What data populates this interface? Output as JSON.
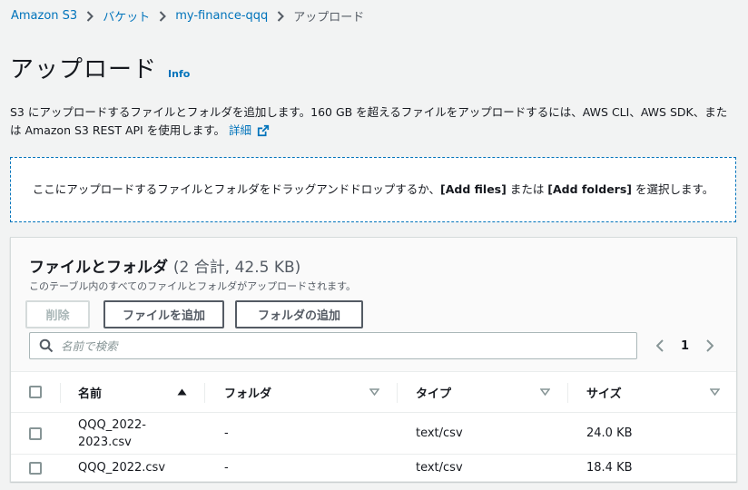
{
  "breadcrumb": {
    "items": [
      "Amazon S3",
      "バケット",
      "my-finance-qqq"
    ],
    "current": "アップロード"
  },
  "page": {
    "title": "アップロード",
    "info": "Info"
  },
  "description": {
    "text": "S3 にアップロードするファイルとフォルダを追加します。160 GB を超えるファイルをアップロードするには、AWS CLI、AWS SDK、または Amazon S3 REST API を使用します。",
    "link": "詳細"
  },
  "dropzone": {
    "before": "ここにアップロードするファイルとフォルダをドラッグアンドドロップするか、",
    "add_files": "[Add files]",
    "middle": " または ",
    "add_folders": "[Add folders]",
    "after": " を選択します。"
  },
  "panel": {
    "title": "ファイルとフォルダ",
    "count": "(2 合計, 42.5 KB)",
    "subtitle": "このテーブル内のすべてのファイルとフォルダがアップロードされます。",
    "buttons": {
      "remove": "削除",
      "add_files": "ファイルを追加",
      "add_folder": "フォルダの追加"
    },
    "search_placeholder": "名前で検索",
    "page_number": "1"
  },
  "table": {
    "headers": {
      "name": "名前",
      "folder": "フォルダ",
      "type": "タイプ",
      "size": "サイズ"
    },
    "rows": [
      {
        "name": "QQQ_2022-2023.csv",
        "folder": "-",
        "type": "text/csv",
        "size": "24.0 KB"
      },
      {
        "name": "QQQ_2022.csv",
        "folder": "-",
        "type": "text/csv",
        "size": "18.4 KB"
      }
    ]
  },
  "colors": {
    "link": "#0073bb",
    "dropzone_border": "#0073bb",
    "button_border": "#545b64",
    "background": "#f2f3f3"
  },
  "icons": {
    "breadcrumb_separator": "chevron-right-icon",
    "external_link": "external-link-icon",
    "search": "search-icon",
    "sort_asc": "caret-up-icon",
    "sort_none": "caret-down-outline-icon",
    "prev": "chevron-left-icon",
    "next": "chevron-right-icon"
  }
}
